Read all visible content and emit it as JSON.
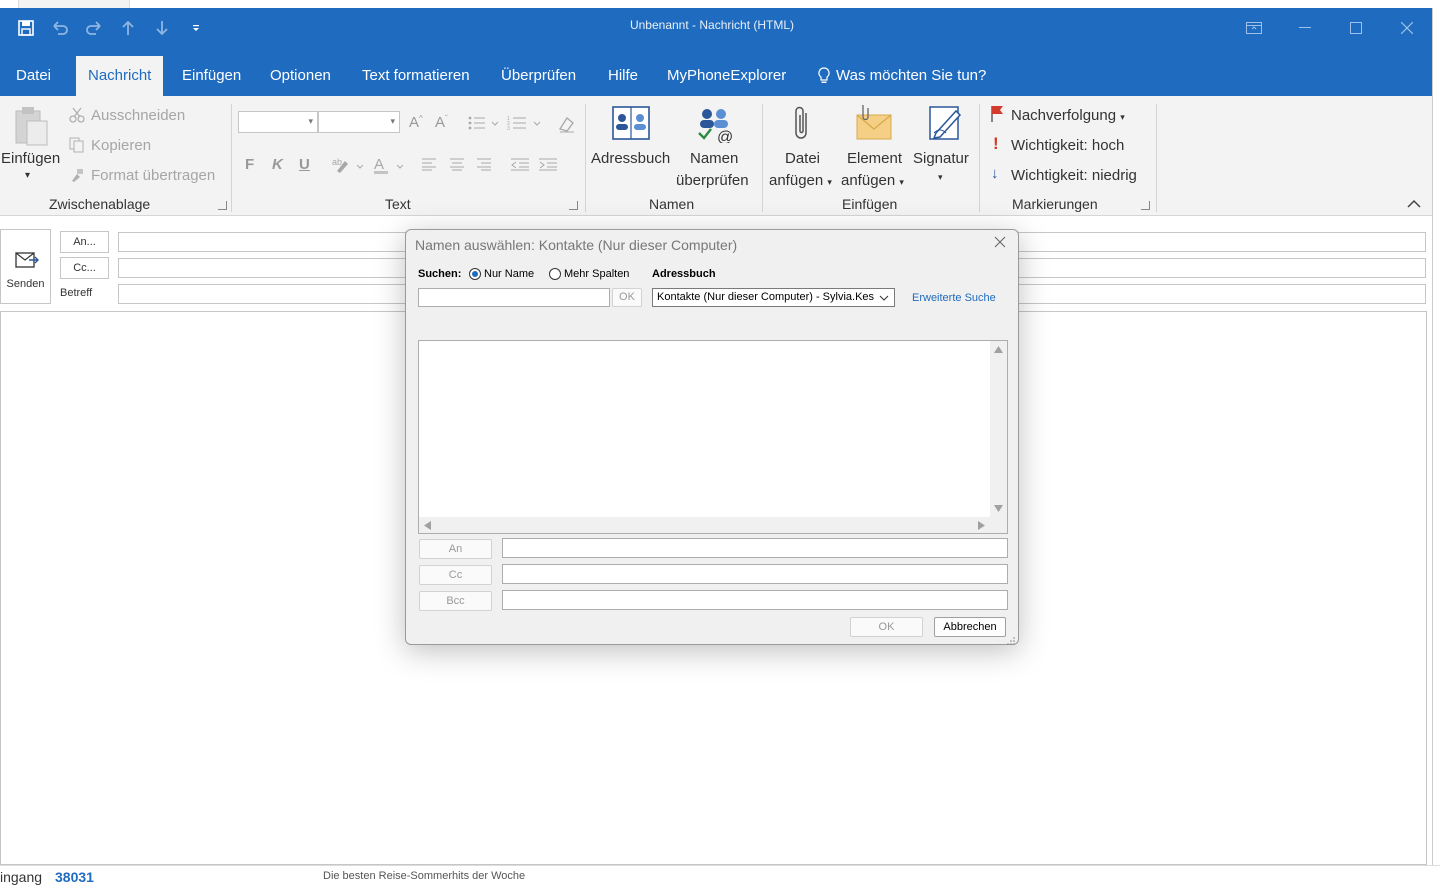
{
  "window": {
    "title": "Unbenannt  -  Nachricht (HTML)"
  },
  "menu": {
    "tabs": [
      {
        "label": "Datei"
      },
      {
        "label": "Nachricht"
      },
      {
        "label": "Einfügen"
      },
      {
        "label": "Optionen"
      },
      {
        "label": "Text formatieren"
      },
      {
        "label": "Überprüfen"
      },
      {
        "label": "Hilfe"
      },
      {
        "label": "MyPhoneExplorer"
      }
    ],
    "tell_me": "Was möchten Sie tun?"
  },
  "ribbon": {
    "clipboard": {
      "paste": "Einfügen",
      "cut": "Ausschneiden",
      "copy": "Kopieren",
      "format_painter": "Format übertragen",
      "label": "Zwischenablage"
    },
    "text": {
      "label": "Text",
      "bold": "F",
      "italic": "K",
      "underline": "U"
    },
    "names": {
      "address_book": "Adressbuch",
      "check_names_1": "Namen",
      "check_names_2": "überprüfen",
      "label": "Namen"
    },
    "insert": {
      "attach_file_1": "Datei",
      "attach_file_2": "anfügen",
      "attach_item_1": "Element",
      "attach_item_2": "anfügen",
      "signature": "Signatur",
      "label": "Einfügen"
    },
    "tags": {
      "follow_up": "Nachverfolgung",
      "high": "Wichtigkeit: hoch",
      "low": "Wichtigkeit: niedrig",
      "label": "Markierungen"
    }
  },
  "compose": {
    "send": "Senden",
    "to": "An...",
    "cc": "Cc...",
    "subject": "Betreff"
  },
  "dialog": {
    "title": "Namen auswählen: Kontakte (Nur dieser Computer)",
    "search_label": "Suchen:",
    "radio_name_only": "Nur Name",
    "radio_more_columns": "Mehr Spalten",
    "address_book_label": "Adressbuch",
    "search_ok": "OK",
    "address_book_value": "Kontakte (Nur dieser Computer) - Sylvia.Kes",
    "advanced_search": "Erweiterte Suche",
    "to_btn": "An",
    "cc_btn": "Cc",
    "bcc_btn": "Bcc",
    "ok": "OK",
    "cancel": "Abbrechen"
  },
  "statusbar": {
    "inbox_fragment": "ingang",
    "count": "38031",
    "preview": "Die besten Reise-Sommerhits der Woche"
  },
  "colors": {
    "accent": "#1f6bbf",
    "ribbon_bg": "#f3f3f3",
    "dialog_bg": "#f0f0f0"
  }
}
